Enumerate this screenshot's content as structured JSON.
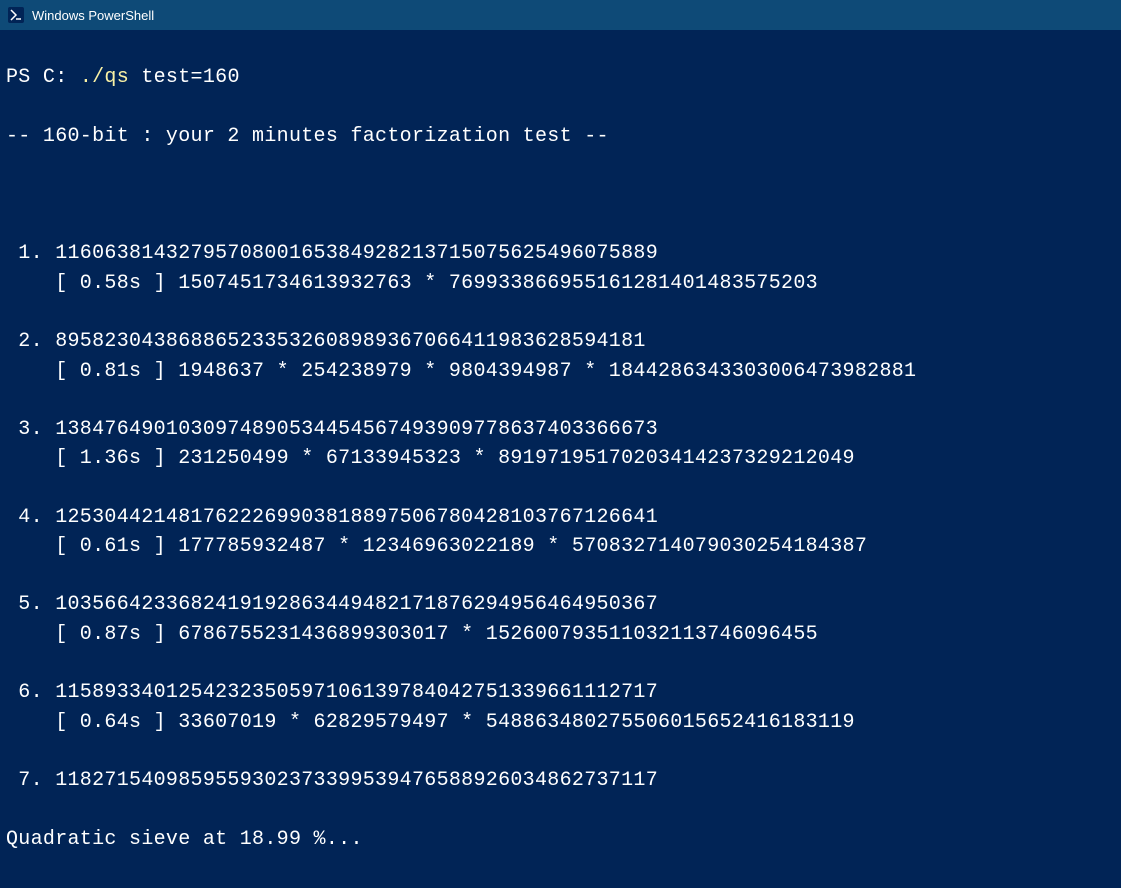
{
  "window": {
    "title": "Windows PowerShell"
  },
  "prompt": {
    "prefix": "PS C: ",
    "command": "./qs",
    "args": " test=160"
  },
  "header": "-- 160-bit : your 2 minutes factorization test --",
  "entries": [
    {
      "num": " 1. ",
      "n": "1160638143279570800165384928213715075625496075889",
      "detail": "    [ 0.58s ] 1507451734613932763 * 769933866955161281401483575203"
    },
    {
      "num": " 2. ",
      "n": "895823043868865233532608989367066411983628594181",
      "detail": "    [ 0.81s ] 1948637 * 254238979 * 9804394987 * 1844286343303006473982881"
    },
    {
      "num": " 3. ",
      "n": "1384764901030974890534454567493909778637403366673",
      "detail": "    [ 1.36s ] 231250499 * 67133945323 * 89197195170203414237329212049"
    },
    {
      "num": " 4. ",
      "n": "1253044214817622269903818897506780428103767126641",
      "detail": "    [ 0.61s ] 177785932487 * 12346963022189 * 570832714079030254184387"
    },
    {
      "num": " 5. ",
      "n": "1035664233682419192863449482171876294956464950367",
      "detail": "    [ 0.87s ] 6786755231436899303017 * 152600793511032113746096455"
    },
    {
      "num": " 6. ",
      "n": "1158933401254232350597106139784042751339661112717",
      "detail": "    [ 0.64s ] 33607019 * 62829579497 * 548863480275506015652416183119"
    },
    {
      "num": " 7. ",
      "n": "1182715409859559302373399539476588926034862737117",
      "detail": null
    }
  ],
  "status": "Quadratic sieve at 18.99 %..."
}
